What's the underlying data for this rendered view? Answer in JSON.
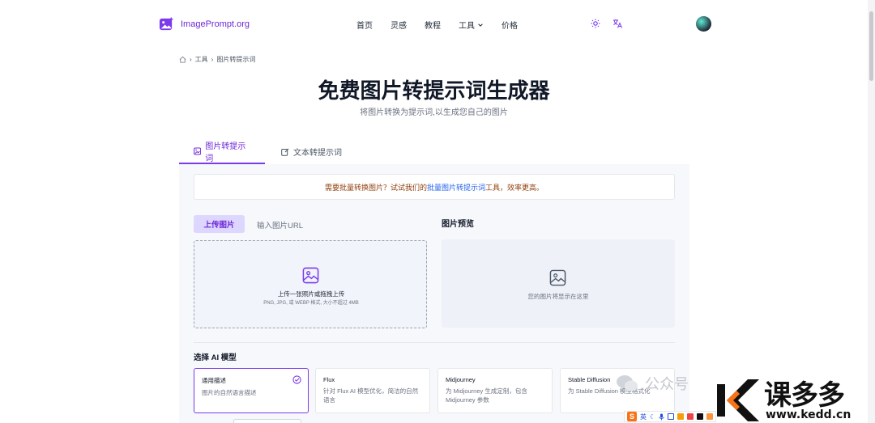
{
  "header": {
    "logo_text": "ImagePrompt.org",
    "nav": {
      "home": "首页",
      "inspiration": "灵感",
      "tutorial": "教程",
      "tools": "工具",
      "pricing": "价格"
    }
  },
  "breadcrumb": {
    "tools": "工具",
    "current": "图片转提示词"
  },
  "page": {
    "title": "免费图片转提示词生成器",
    "subtitle": "将图片转换为提示词,以生成您自己的图片"
  },
  "tabs": {
    "image_to_prompt": "图片转提示词",
    "text_to_prompt": "文本转提示词"
  },
  "notice": {
    "prefix": "需要批量转换图片？试试我们的",
    "link": "批量图片转提示词",
    "suffix": "工具，效率更高。"
  },
  "upload": {
    "tab_upload": "上传图片",
    "tab_url": "输入图片URL",
    "drop_text": "上传一张照片或拖拽上传",
    "formats": "PNG, JPG, 或 WEBP 格式, 大小不超过 4MB"
  },
  "preview": {
    "title": "图片预览",
    "placeholder": "您的图片将显示在这里"
  },
  "models": {
    "title": "选择 AI 模型",
    "cards": [
      {
        "title": "通用描述",
        "desc": "图片的自然语言描述"
      },
      {
        "title": "Flux",
        "desc": "针对 Flux AI 模型优化，简洁的自然语言"
      },
      {
        "title": "Midjourney",
        "desc": "为 Midjourney 生成定制，包含 Midjourney 参数"
      },
      {
        "title": "Stable Diffusion",
        "desc": "为 Stable Diffusion 模型格式化"
      }
    ]
  },
  "watermark": {
    "wechat": "公众号",
    "brand": "课多多",
    "url": "www.kedd.cn"
  },
  "ime": {
    "lang": "英"
  },
  "colors": {
    "accent": "#7c3aed",
    "accent_light": "#ddd6fe",
    "notice_text": "#92400e",
    "link": "#2563eb"
  }
}
